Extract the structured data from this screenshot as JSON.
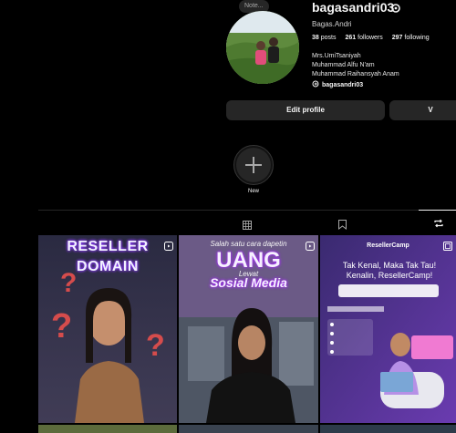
{
  "profile": {
    "note": "Note...",
    "username": "bagasandri03",
    "full_name": "Bagas.Andri",
    "stats": {
      "posts": "38",
      "posts_label": "posts",
      "followers": "261",
      "followers_label": "followers",
      "following": "297",
      "following_label": "following"
    },
    "bio_lines": [
      "Mrs.UmiTsaniyah",
      "Muhammad Alfu N'am",
      "Muhammad Raihansyah Anam"
    ],
    "threads_handle": "bagasandri03"
  },
  "actions": {
    "edit_profile": "Edit profile",
    "view_archive": "V"
  },
  "highlights": {
    "new_label": "New"
  },
  "tabs": {
    "icons": [
      "grid-icon",
      "saved-icon",
      "reposts-icon"
    ],
    "active": "reposts-icon"
  },
  "posts": [
    {
      "title_line1": "RESELLER",
      "title_line2": "DOMAIN"
    },
    {
      "kicker": "Salah satu cara dapetin",
      "headline": "UANG",
      "connector": "Lewat",
      "subline": "Sosial Media"
    },
    {
      "brand": "ResellerCamp",
      "headline": "Tak Kenal, Maka Tak Tau! Kenalin, ResellerCamp!"
    }
  ],
  "colors": {
    "background": "#000000",
    "button": "#262626",
    "text": "#f5f5f5",
    "muted": "#a8a8a8",
    "accent_purple": "#7b2ff7"
  }
}
